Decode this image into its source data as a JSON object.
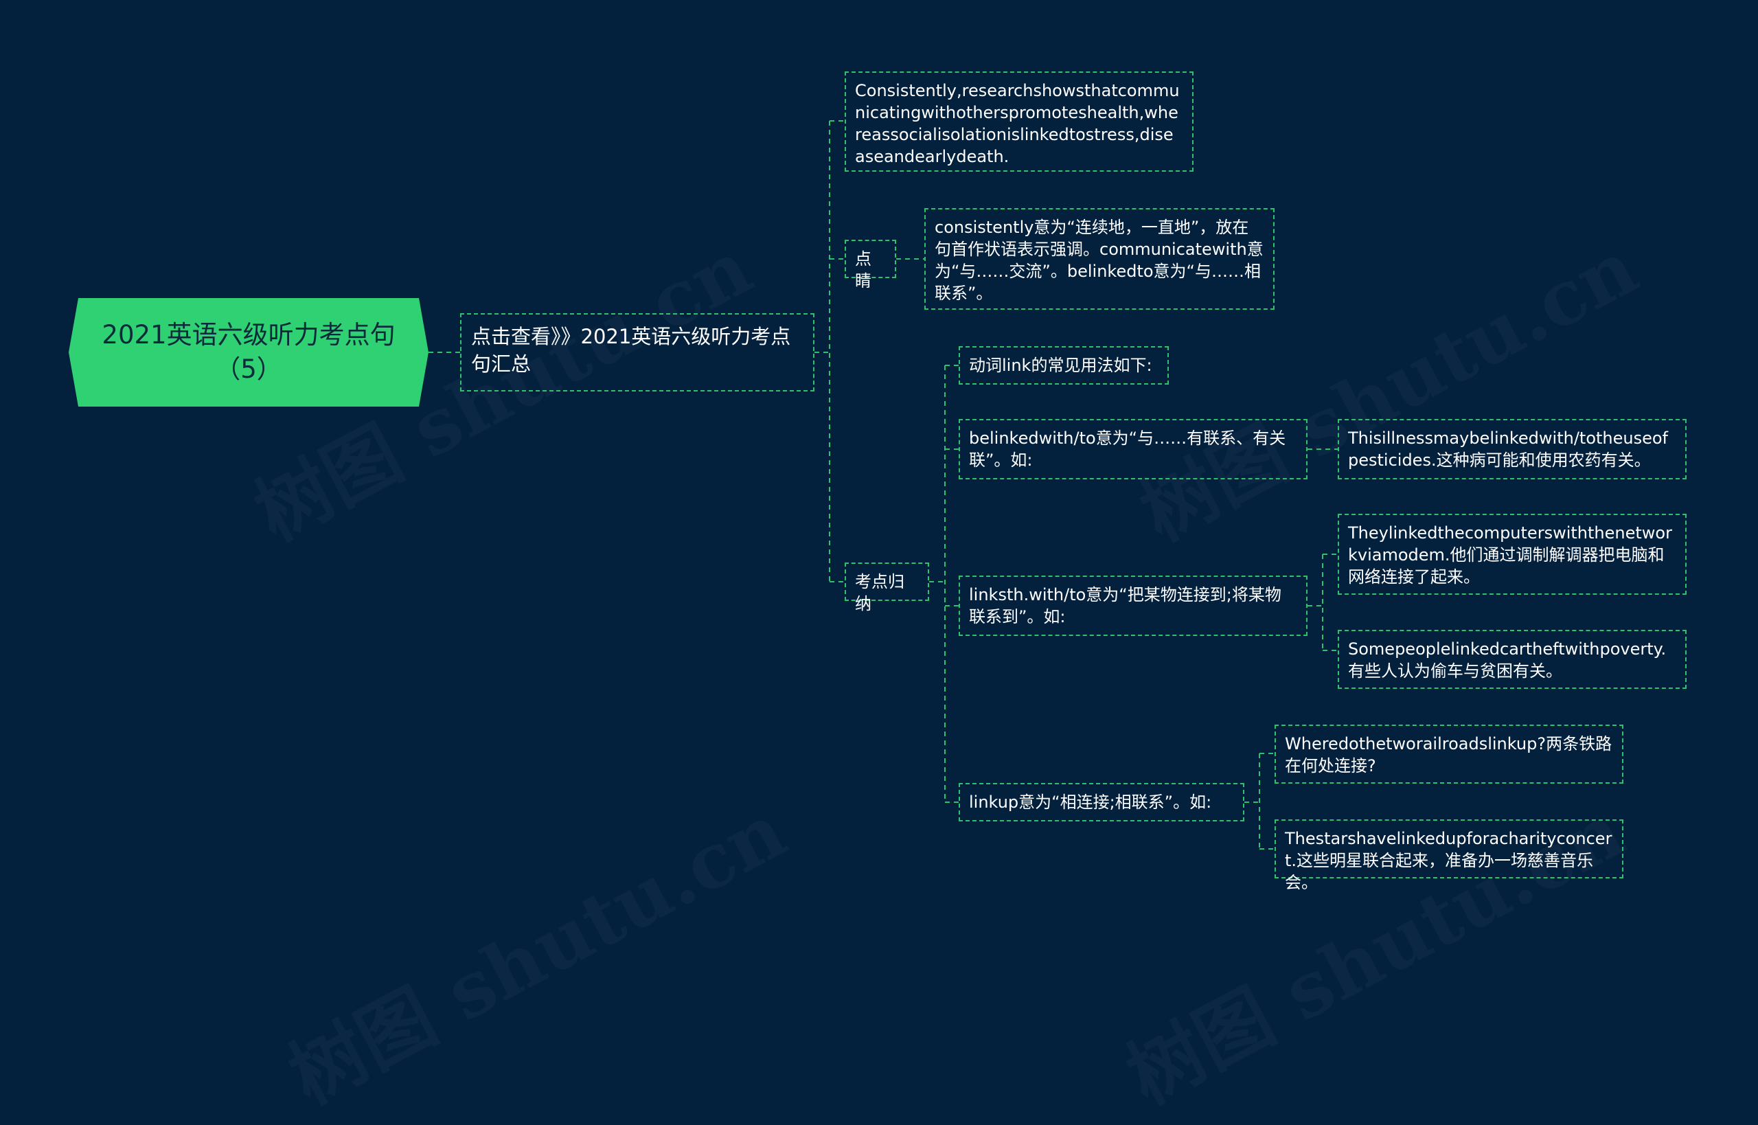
{
  "watermark": "树图 shutu.cn",
  "colors": {
    "background": "#03203d",
    "line": "#2fc26c",
    "root_fill": "#2fd173",
    "text": "#ffffff"
  },
  "root": {
    "text": "2021英语六级听力考点句（5）"
  },
  "link_node": {
    "text": "点击查看》》2021英语六级听力考点句汇总"
  },
  "sentence": {
    "text": "Consistently,researchshowsthatcommunicatingwithotherspromoteshealth,whereassocialisolationislinkedtostress,diseaseandearlydeath."
  },
  "dianjing": {
    "label": "点睛",
    "content": "consistently意为“连续地，一直地”，放在句首作状语表示强调。communicatewith意为“与……交流”。belinkedto意为“与……相联系”。"
  },
  "kaodian": {
    "label": "考点归纳",
    "intro": "动词link的常见用法如下:",
    "usage1": {
      "text": "belinkedwith/to意为“与……有联系、有关联”。如:",
      "example": "Thisillnessmaybelinkedwith/totheuseofpesticides.这种病可能和使用农药有关。"
    },
    "usage2": {
      "text": "linksth.with/to意为“把某物连接到;将某物联系到”。如:",
      "example1": "Theylinkedthecomputerswiththenetworkviamodem.他们通过调制解调器把电脑和网络连接了起来。",
      "example2": "Somepeoplelinkedcartheftwithpoverty.有些人认为偷车与贫困有关。"
    },
    "usage3": {
      "text": "linkup意为“相连接;相联系”。如:",
      "example1": "Wheredothetworailroadslinkup?两条铁路在何处连接?",
      "example2": "Thestarshavelinkedupforacharityconcert.这些明星联合起来，准备办一场慈善音乐会。"
    }
  }
}
